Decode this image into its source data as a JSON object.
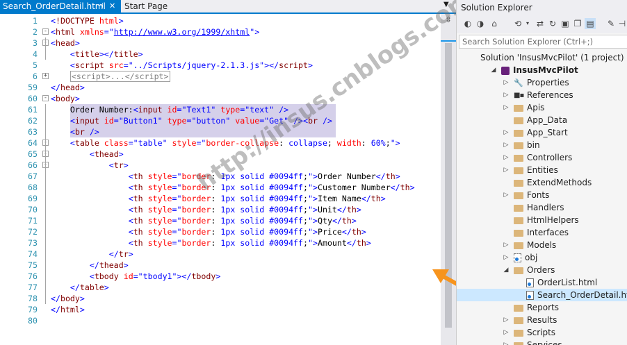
{
  "tabs": [
    {
      "label": "Search_OrderDetail.html",
      "active": true
    },
    {
      "label": "Start Page",
      "active": false
    }
  ],
  "tab_icons": {
    "pin": "pin-icon",
    "close": "close-icon",
    "dropdown": "dropdown-icon"
  },
  "code_lines": [
    {
      "n": "1",
      "html": "<span class='bl'>&lt;</span><span class='tg'>!DOCTYPE</span> <span class='at'>html</span><span class='bl'>&gt;</span>"
    },
    {
      "n": "2",
      "html": "<span class='bl'>&lt;</span><span class='tg'>html</span> <span class='at'>xmlns</span><span class='bl'>=\"</span><span class='lk'>http://www.w3.org/1999/xhtml</span><span class='bl'>\"&gt;</span>"
    },
    {
      "n": "3",
      "html": "<span class='bl'>&lt;</span><span class='tg'>head</span><span class='bl'>&gt;</span>"
    },
    {
      "n": "4",
      "html": "    <span class='bl'>&lt;</span><span class='tg'>title</span><span class='bl'>&gt;&lt;/</span><span class='tg'>title</span><span class='bl'>&gt;</span>"
    },
    {
      "n": "5",
      "html": "    <span class='bl'>&lt;</span><span class='tg'>script</span> <span class='at'>src</span><span class='bl'>=\"../Scripts/jquery-2.1.3.js\"&gt;&lt;/</span><span class='tg'>script</span><span class='bl'>&gt;</span>"
    },
    {
      "n": "6",
      "html": "    <span class='collapsed'>&lt;script&gt;...&lt;/script&gt;</span>"
    },
    {
      "n": "59",
      "html": "<span class='bl'>&lt;/</span><span class='tg'>head</span><span class='bl'>&gt;</span>"
    },
    {
      "n": "60",
      "html": "<span class='bl'>&lt;</span><span class='tg'>body</span><span class='bl'>&gt;</span>"
    },
    {
      "n": "61",
      "html": "    Order Number:<span class='bl'>&lt;</span><span class='tg'>input</span> <span class='at'>id</span><span class='bl'>=\"Text1\"</span> <span class='at'>type</span><span class='bl'>=\"text\"</span> <span class='bl'>/&gt;</span>"
    },
    {
      "n": "62",
      "html": "    <span class='bl'>&lt;</span><span class='tg'>input</span> <span class='at'>id</span><span class='bl'>=\"Button1\"</span> <span class='at'>type</span><span class='bl'>=\"button\"</span> <span class='at'>value</span><span class='bl'>=\"Get\"</span> <span class='bl'>/&gt;&lt;</span><span class='tg'>br</span> <span class='bl'>/&gt;</span>"
    },
    {
      "n": "63",
      "html": "    <span class='bl'>&lt;</span><span class='tg'>br</span> <span class='bl'>/&gt;</span>"
    },
    {
      "n": "64",
      "html": "    <span class='bl'>&lt;</span><span class='tg'>table</span> <span class='at'>class</span><span class='bl'>=\"table\"</span> <span class='at'>style</span><span class='bl'>=\"</span><span class='at'>border-collapse</span>: <span class='bl'>collapse</span>; <span class='at'>width</span>: <span class='bl'>60%</span>;<span class='bl'>\"&gt;</span>"
    },
    {
      "n": "65",
      "html": "        <span class='bl'>&lt;</span><span class='tg'>thead</span><span class='bl'>&gt;</span>"
    },
    {
      "n": "66",
      "html": "            <span class='bl'>&lt;</span><span class='tg'>tr</span><span class='bl'>&gt;</span>"
    },
    {
      "n": "67",
      "html": "                <span class='bl'>&lt;</span><span class='tg'>th</span> <span class='at'>style</span><span class='bl'>=\"</span><span class='at'>border</span>: <span class='bl'>1px solid #0094ff</span>;<span class='bl'>\"&gt;</span>Order Number<span class='bl'>&lt;/</span><span class='tg'>th</span><span class='bl'>&gt;</span>"
    },
    {
      "n": "68",
      "html": "                <span class='bl'>&lt;</span><span class='tg'>th</span> <span class='at'>style</span><span class='bl'>=\"</span><span class='at'>border</span>: <span class='bl'>1px solid #0094ff</span>;<span class='bl'>\"&gt;</span>Customer Number<span class='bl'>&lt;/</span><span class='tg'>th</span><span class='bl'>&gt;</span>"
    },
    {
      "n": "69",
      "html": "                <span class='bl'>&lt;</span><span class='tg'>th</span> <span class='at'>style</span><span class='bl'>=\"</span><span class='at'>border</span>: <span class='bl'>1px solid #0094ff</span>;<span class='bl'>\"&gt;</span>Item Name<span class='bl'>&lt;/</span><span class='tg'>th</span><span class='bl'>&gt;</span>"
    },
    {
      "n": "70",
      "html": "                <span class='bl'>&lt;</span><span class='tg'>th</span> <span class='at'>style</span><span class='bl'>=\"</span><span class='at'>border</span>: <span class='bl'>1px solid #0094ff</span>;<span class='bl'>\"&gt;</span>Unit<span class='bl'>&lt;/</span><span class='tg'>th</span><span class='bl'>&gt;</span>"
    },
    {
      "n": "71",
      "html": "                <span class='bl'>&lt;</span><span class='tg'>th</span> <span class='at'>style</span><span class='bl'>=\"</span><span class='at'>border</span>: <span class='bl'>1px solid #0094ff</span>;<span class='bl'>\"&gt;</span>Qty<span class='bl'>&lt;/</span><span class='tg'>th</span><span class='bl'>&gt;</span>"
    },
    {
      "n": "72",
      "html": "                <span class='bl'>&lt;</span><span class='tg'>th</span> <span class='at'>style</span><span class='bl'>=\"</span><span class='at'>border</span>: <span class='bl'>1px solid #0094ff</span>;<span class='bl'>\"&gt;</span>Price<span class='bl'>&lt;/</span><span class='tg'>th</span><span class='bl'>&gt;</span>"
    },
    {
      "n": "73",
      "html": "                <span class='bl'>&lt;</span><span class='tg'>th</span> <span class='at'>style</span><span class='bl'>=\"</span><span class='at'>border</span>: <span class='bl'>1px solid #0094ff</span>;<span class='bl'>\"&gt;</span>Amount<span class='bl'>&lt;/</span><span class='tg'>th</span><span class='bl'>&gt;</span>"
    },
    {
      "n": "74",
      "html": "            <span class='bl'>&lt;/</span><span class='tg'>tr</span><span class='bl'>&gt;</span>"
    },
    {
      "n": "75",
      "html": "        <span class='bl'>&lt;/</span><span class='tg'>thead</span><span class='bl'>&gt;</span>"
    },
    {
      "n": "76",
      "html": "        <span class='bl'>&lt;</span><span class='tg'>tbody</span> <span class='at'>id</span><span class='bl'>=\"tbody1\"&gt;&lt;/</span><span class='tg'>tbody</span><span class='bl'>&gt;</span>"
    },
    {
      "n": "77",
      "html": "    <span class='bl'>&lt;/</span><span class='tg'>table</span><span class='bl'>&gt;</span>"
    },
    {
      "n": "78",
      "html": "<span class='bl'>&lt;/</span><span class='tg'>body</span><span class='bl'>&gt;</span>"
    },
    {
      "n": "79",
      "html": "<span class='bl'>&lt;/</span><span class='tg'>html</span><span class='bl'>&gt;</span>"
    },
    {
      "n": "80",
      "html": ""
    }
  ],
  "fold_markers": [
    {
      "line": 2,
      "sym": "-"
    },
    {
      "line": 3,
      "sym": "-"
    },
    {
      "line": 6,
      "sym": "+"
    },
    {
      "line": 60,
      "sym": "-"
    },
    {
      "line": 64,
      "sym": "-"
    },
    {
      "line": 65,
      "sym": "-"
    },
    {
      "line": 66,
      "sym": "-"
    }
  ],
  "watermark": "http://insus.cnblogs.com",
  "solution_explorer": {
    "title": "Solution Explorer",
    "search_placeholder": "Search Solution Explorer (Ctrl+;)",
    "toolbar_icons": [
      "back-icon",
      "forward-icon",
      "home-icon",
      "history-icon",
      "dropdown-icon",
      "sync-icon",
      "refresh-icon",
      "collapse-all-icon",
      "show-all-files-icon",
      "preview-icon",
      "properties-icon",
      "pin-icon"
    ],
    "tree": [
      {
        "label": "Solution 'InsusMvcPilot' (1 project)",
        "kind": "solution",
        "indent": 0,
        "exp": ""
      },
      {
        "label": "InsusMvcPilot",
        "kind": "project",
        "indent": 1,
        "exp": "◢",
        "bold": true
      },
      {
        "label": "Properties",
        "kind": "gear",
        "indent": 2,
        "exp": "▷"
      },
      {
        "label": "References",
        "kind": "refs",
        "indent": 2,
        "exp": "▷"
      },
      {
        "label": "Apis",
        "kind": "folder",
        "indent": 2,
        "exp": "▷"
      },
      {
        "label": "App_Data",
        "kind": "folder",
        "indent": 2,
        "exp": ""
      },
      {
        "label": "App_Start",
        "kind": "folder",
        "indent": 2,
        "exp": "▷"
      },
      {
        "label": "bin",
        "kind": "folder",
        "indent": 2,
        "exp": "▷"
      },
      {
        "label": "Controllers",
        "kind": "folder",
        "indent": 2,
        "exp": "▷"
      },
      {
        "label": "Entities",
        "kind": "folder",
        "indent": 2,
        "exp": "▷"
      },
      {
        "label": "ExtendMethods",
        "kind": "folder",
        "indent": 2,
        "exp": ""
      },
      {
        "label": "Fonts",
        "kind": "folder",
        "indent": 2,
        "exp": "▷"
      },
      {
        "label": "Handlers",
        "kind": "folder",
        "indent": 2,
        "exp": ""
      },
      {
        "label": "HtmlHelpers",
        "kind": "folder",
        "indent": 2,
        "exp": ""
      },
      {
        "label": "Interfaces",
        "kind": "folder",
        "indent": 2,
        "exp": ""
      },
      {
        "label": "Models",
        "kind": "folder",
        "indent": 2,
        "exp": "▷"
      },
      {
        "label": "obj",
        "kind": "file-plain",
        "indent": 2,
        "exp": "▷"
      },
      {
        "label": "Orders",
        "kind": "folder",
        "indent": 2,
        "exp": "◢"
      },
      {
        "label": "OrderList.html",
        "kind": "file",
        "indent": 3,
        "exp": ""
      },
      {
        "label": "Search_OrderDetail.html",
        "kind": "file",
        "indent": 3,
        "exp": "",
        "selected": true
      },
      {
        "label": "Reports",
        "kind": "folder",
        "indent": 2,
        "exp": ""
      },
      {
        "label": "Results",
        "kind": "folder",
        "indent": 2,
        "exp": "▷"
      },
      {
        "label": "Scripts",
        "kind": "folder",
        "indent": 2,
        "exp": "▷"
      },
      {
        "label": "Services",
        "kind": "folder",
        "indent": 2,
        "exp": "▷"
      }
    ]
  },
  "colors": {
    "accent": "#007acc",
    "selection": "#cce8ff",
    "highlight": "#d5d0ea",
    "arrow": "#f7941d"
  }
}
